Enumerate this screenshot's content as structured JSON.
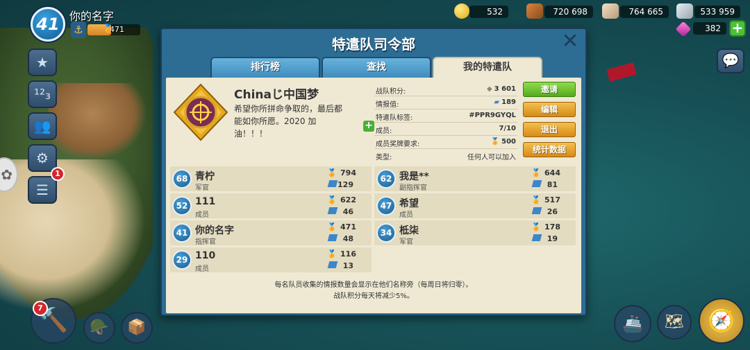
{
  "player": {
    "name": "你的名字",
    "level": "41",
    "victory_points": "471",
    "vp_fill_fraction": 0.45
  },
  "resources": {
    "gold": "532",
    "wood": "720 698",
    "stone": "764 665",
    "iron": "533 959",
    "diamonds": "382"
  },
  "hud": {
    "notification_count": "1",
    "builder_count": "7"
  },
  "dialog": {
    "title": "特遣队司令部",
    "close": "✕",
    "tabs": [
      {
        "label": "排行榜"
      },
      {
        "label": "查找"
      },
      {
        "label": "我的特遣队"
      }
    ]
  },
  "squad": {
    "name": "Chinaじ中国梦",
    "description": "希望你所拼命争取的，最后都能如你所愿。2020 加油！！！",
    "stats": [
      {
        "label": "战队积分:",
        "value": "3 601"
      },
      {
        "label": "情报值:",
        "value": "189"
      },
      {
        "label": "特遣队标签:",
        "value": "#PPR9GYQL"
      },
      {
        "label": "成员:",
        "value": "7/10"
      },
      {
        "label": "成员奖牌要求:",
        "value": "500"
      },
      {
        "label": "类型:",
        "value": "任何人可以加入"
      }
    ]
  },
  "buttons": {
    "invite": "邀请",
    "edit": "编辑",
    "leave": "退出",
    "stats": "统计数据"
  },
  "members": [
    {
      "level": "68",
      "name": "青柠",
      "role": "军官",
      "vp": "794",
      "intel": "129"
    },
    {
      "level": "62",
      "name": "我是**",
      "role": "副指挥官",
      "vp": "644",
      "intel": "81"
    },
    {
      "level": "52",
      "name": "111",
      "role": "成员",
      "vp": "622",
      "intel": "46"
    },
    {
      "level": "47",
      "name": "希望",
      "role": "成员",
      "vp": "517",
      "intel": "26"
    },
    {
      "level": "41",
      "name": "你的名字",
      "role": "指挥官",
      "vp": "471",
      "intel": "48"
    },
    {
      "level": "34",
      "name": "柢柒",
      "role": "军官",
      "vp": "178",
      "intel": "19"
    },
    {
      "level": "29",
      "name": "110",
      "role": "成员",
      "vp": "116",
      "intel": "13"
    }
  ],
  "footer": {
    "line1": "每名队员收集的情报数量会显示在他们名称旁（每周日将归零）。",
    "line2": "战队积分每天将减少5%。"
  }
}
